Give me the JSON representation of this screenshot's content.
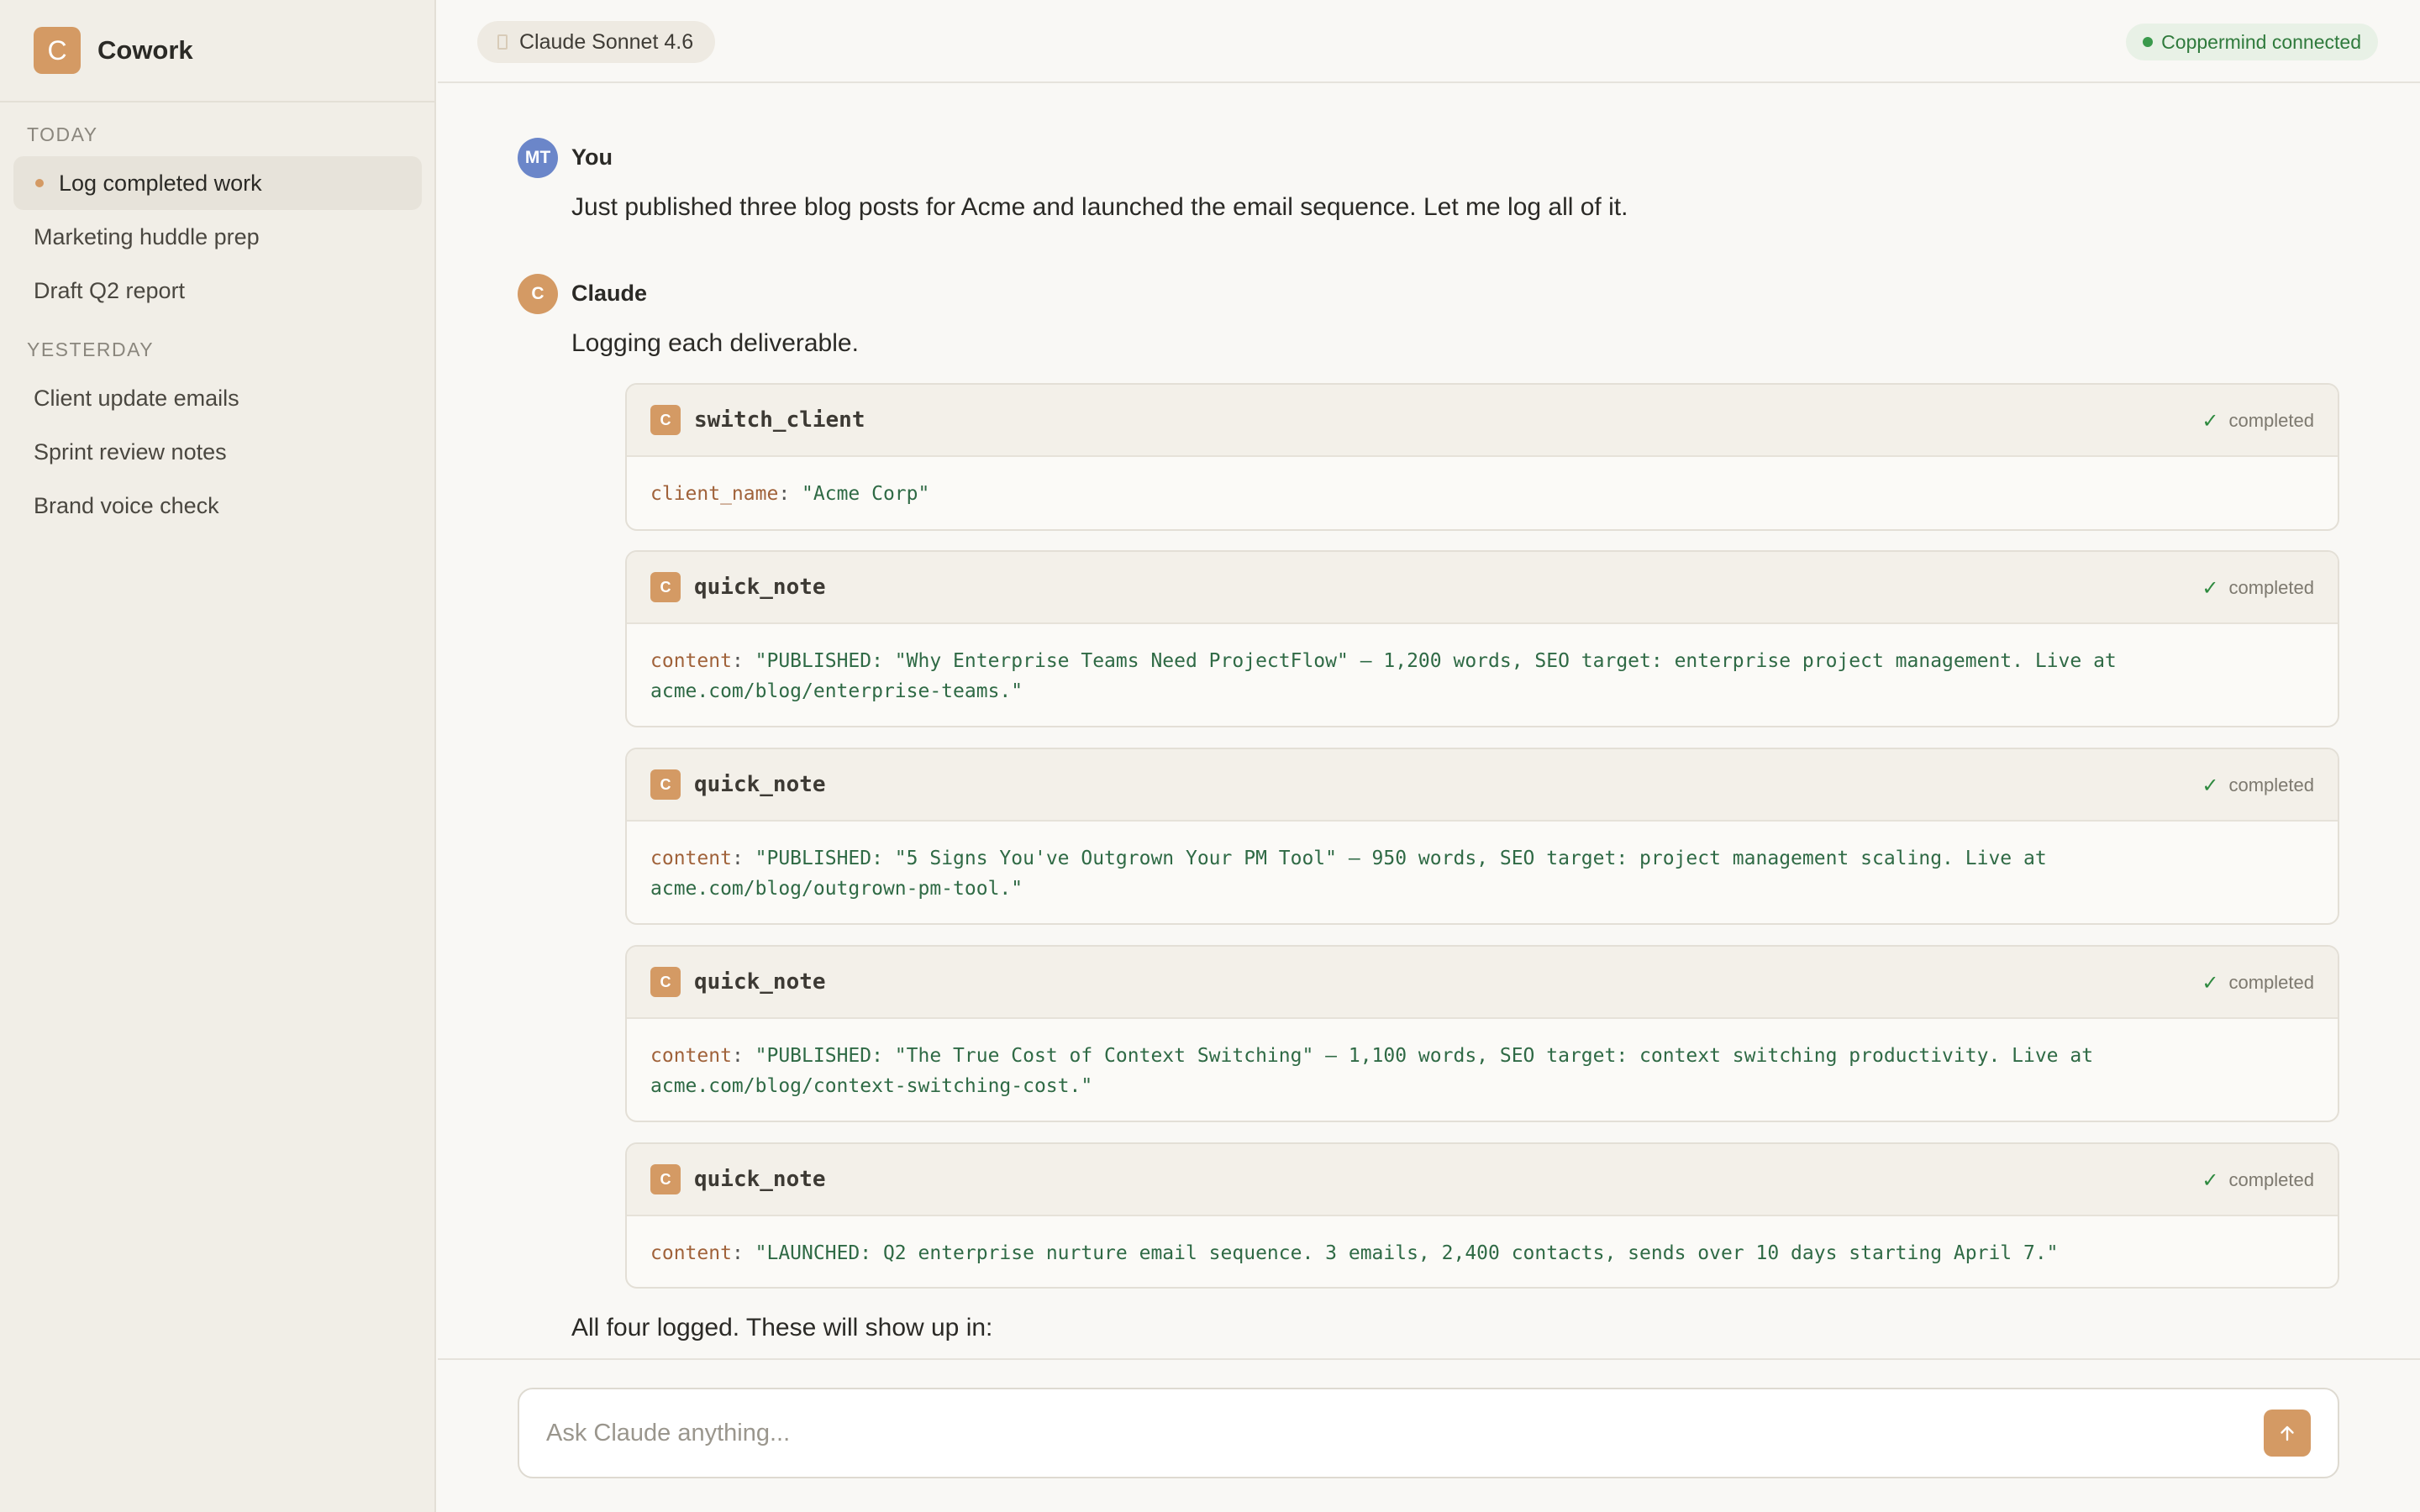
{
  "app": {
    "name": "Cowork",
    "logo_letter": "C"
  },
  "sidebar": {
    "sections": [
      {
        "label": "TODAY",
        "items": [
          {
            "label": "Log completed work",
            "active": true
          },
          {
            "label": "Marketing huddle prep"
          },
          {
            "label": "Draft Q2 report"
          }
        ]
      },
      {
        "label": "YESTERDAY",
        "items": [
          {
            "label": "Client update emails"
          },
          {
            "label": "Sprint review notes"
          },
          {
            "label": "Brand voice check"
          }
        ]
      }
    ]
  },
  "header": {
    "model": "Claude Sonnet 4.6",
    "connection": "Coppermind connected"
  },
  "messages": {
    "user": {
      "initials": "MT",
      "author": "You",
      "text": "Just published three blog posts for Acme and launched the email sequence. Let me log all of it."
    },
    "assistant": {
      "initials": "C",
      "author": "Claude",
      "intro": "Logging each deliverable.",
      "outro": "All four logged. These will show up in:"
    }
  },
  "tool_calls": [
    {
      "icon": "C",
      "name": "switch_client",
      "status": "completed",
      "arg_key": "client_name",
      "arg_value": "\"Acme Corp\""
    },
    {
      "icon": "C",
      "name": "quick_note",
      "status": "completed",
      "arg_key": "content",
      "arg_value_line1": "\"PUBLISHED: \"Why Enterprise Teams Need ProjectFlow\" — 1,200 words, SEO target: enterprise project management. Live at",
      "arg_value_line2": "acme.com/blog/enterprise-teams.\""
    },
    {
      "icon": "C",
      "name": "quick_note",
      "status": "completed",
      "arg_key": "content",
      "arg_value_line1": "\"PUBLISHED: \"5 Signs You've Outgrown Your PM Tool\" — 950 words, SEO target: project management scaling. Live at",
      "arg_value_line2": "acme.com/blog/outgrown-pm-tool.\""
    },
    {
      "icon": "C",
      "name": "quick_note",
      "status": "completed",
      "arg_key": "content",
      "arg_value_line1": "\"PUBLISHED: \"The True Cost of Context Switching\" — 1,100 words, SEO target: context switching productivity. Live at",
      "arg_value_line2": "acme.com/blog/context-switching-cost.\""
    },
    {
      "icon": "C",
      "name": "quick_note",
      "status": "completed",
      "arg_key": "content",
      "arg_value": "\"LAUNCHED: Q2 enterprise nurture email sequence. 3 emails, 2,400 contacts, sends over 10 days starting April 7.\""
    }
  ],
  "composer": {
    "placeholder": "Ask Claude anything..."
  },
  "colors": {
    "accent": "#d49a64",
    "user_avatar": "#6b86c9",
    "connected": "#2f7a3c"
  },
  "icons": {
    "send": "arrow-up-icon",
    "check": "checkmark-icon",
    "status": "dot-icon"
  }
}
